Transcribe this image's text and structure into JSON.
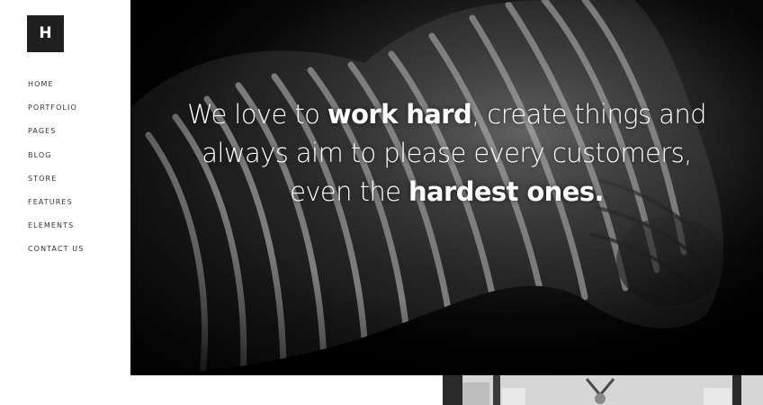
{
  "brand": {
    "logo_letter": "H"
  },
  "nav": {
    "items": [
      {
        "label": "HOME"
      },
      {
        "label": "PORTFOLIO"
      },
      {
        "label": "PAGES"
      },
      {
        "label": "BLOG"
      },
      {
        "label": "STORE"
      },
      {
        "label": "FEATURES"
      },
      {
        "label": "ELEMENTS"
      },
      {
        "label": "CONTACT US"
      }
    ]
  },
  "hero": {
    "line1_normal": "We love to ",
    "line1_bold": "work hard",
    "line1_rest": ", create things and",
    "line2": "always aim to please every customers,",
    "line3_normal": "even the ",
    "line3_bold": "hardest ones.",
    "image": "zebra-photo"
  },
  "colors": {
    "logo_bg": "#1f1f1f",
    "hero_bg": "#000000",
    "text": "#333333",
    "hero_text": "#ffffff"
  }
}
